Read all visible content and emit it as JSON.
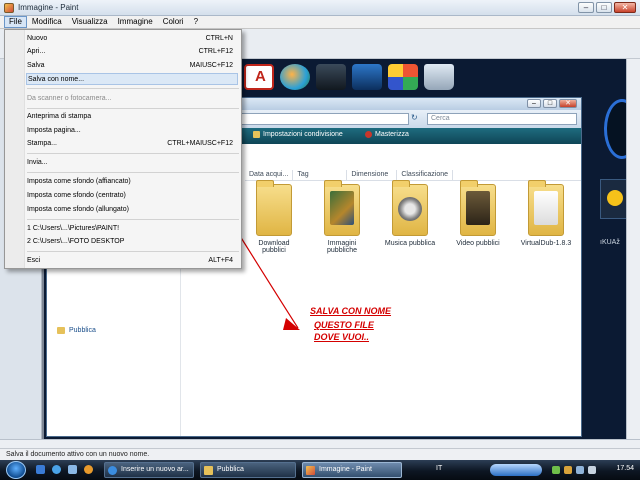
{
  "window": {
    "title": "Immagine - Paint",
    "minimize": "–",
    "maximize": "□",
    "close": "✕"
  },
  "menubar": {
    "items": [
      "File",
      "Modifica",
      "Visualizza",
      "Immagine",
      "Colori",
      "?"
    ]
  },
  "file_menu": {
    "items": [
      {
        "label": "Nuovo",
        "shortcut": "CTRL+N"
      },
      {
        "label": "Apri...",
        "shortcut": "CTRL+F12"
      },
      {
        "label": "Salva",
        "shortcut": "MAIUSC+F12"
      },
      {
        "label": "Salva con nome...",
        "shortcut": ""
      },
      {
        "label": "Da scanner o fotocamera...",
        "shortcut": ""
      },
      {
        "label": "Anteprima di stampa",
        "shortcut": ""
      },
      {
        "label": "Imposta pagina...",
        "shortcut": ""
      },
      {
        "label": "Stampa...",
        "shortcut": "CTRL+MAIUSC+F12"
      },
      {
        "label": "Invia...",
        "shortcut": ""
      },
      {
        "label": "Imposta come sfondo (affiancato)",
        "shortcut": ""
      },
      {
        "label": "Imposta come sfondo (centrato)",
        "shortcut": ""
      },
      {
        "label": "Imposta come sfondo (allungato)",
        "shortcut": ""
      },
      {
        "label": "1 C:\\Users\\...\\Pictures\\PAINT!",
        "shortcut": ""
      },
      {
        "label": "2 C:\\Users\\...\\FOTO DESKTOP",
        "shortcut": ""
      },
      {
        "label": "Esci",
        "shortcut": "ALT+F4"
      }
    ]
  },
  "explorer": {
    "search_placeholder": "Cerca",
    "nav_arrows": "↻",
    "toolbar": {
      "share": "Impostazioni condivisione",
      "burn": "Masterizza"
    },
    "columns": [
      "Data acqui...",
      "Tag",
      "Dimensione",
      "Classificazione"
    ],
    "sidebar_item": "Pubblica",
    "folders": [
      "Download pubblici",
      "Immagini pubbliche",
      "Musica pubblica",
      "Video pubblici",
      "VirtualDub-1.8.3"
    ]
  },
  "annotation": {
    "line1": "SALVA CON NOME",
    "line2": "QUESTO FILE",
    "line3": "DOVE VUOI..",
    "color": "#d40000"
  },
  "desktop": {
    "side_text": "ıKUAž"
  },
  "statusbar": {
    "text": "Salva il documento attivo con un nuovo nome."
  },
  "taskbar": {
    "tasks": [
      "Inserire un nuovo ar...",
      "Pubblica",
      "Immagine - Paint"
    ],
    "language": "IT",
    "time": "17.54"
  }
}
